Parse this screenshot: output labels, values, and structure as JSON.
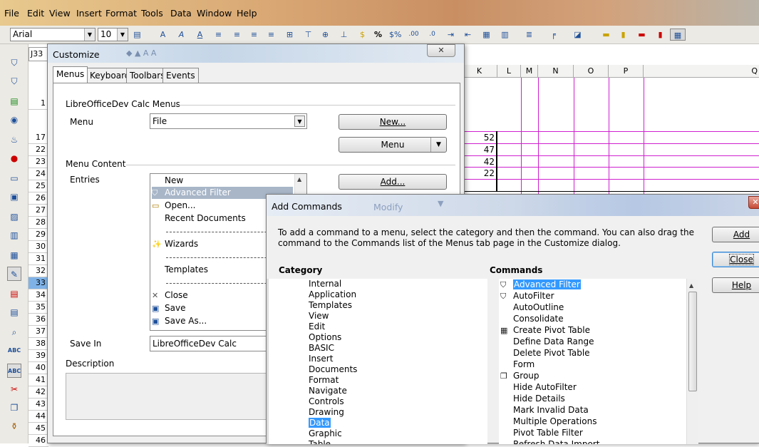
{
  "menubar": {
    "items": [
      "File",
      "Edit",
      "View",
      "Insert",
      "Format",
      "Tools",
      "Data",
      "Window",
      "Help"
    ]
  },
  "format_toolbar": {
    "font_name": "Arial",
    "font_size": "10"
  },
  "sheet": {
    "name_box": "J33",
    "columns": [
      "K",
      "L",
      "M",
      "N",
      "O",
      "P",
      "Q"
    ],
    "rows": [
      "1",
      "17",
      "22",
      "23",
      "24",
      "25",
      "26",
      "27",
      "28",
      "29",
      "30",
      "31",
      "32",
      "33",
      "34",
      "35",
      "36",
      "37",
      "38",
      "39",
      "40",
      "41",
      "42",
      "43",
      "44",
      "45",
      "46"
    ],
    "selected_row": "33",
    "cell_values": [
      "52",
      "47",
      "42",
      "22"
    ]
  },
  "customize": {
    "title": "Customize",
    "close_glyph": "✕",
    "tabs": [
      "Menus",
      "Keyboard",
      "Toolbars",
      "Events"
    ],
    "group_menus": "LibreOfficeDev Calc Menus",
    "menu_label": "Menu",
    "menu_value": "File",
    "new_button": "New...",
    "menu_button": "Menu",
    "group_content": "Menu Content",
    "entries_label": "Entries",
    "entries": [
      {
        "label": "New",
        "icon": "none"
      },
      {
        "label": "Advanced Filter",
        "icon": "filter-icon"
      },
      {
        "label": "Open...",
        "icon": "folder-open-icon"
      },
      {
        "label": "Recent Documents",
        "icon": "none"
      },
      {
        "label": "Wizards",
        "icon": "wizard-icon"
      },
      {
        "label": "Templates",
        "icon": "none"
      },
      {
        "label": "Close",
        "icon": "close-icon"
      },
      {
        "label": "Save",
        "icon": "save-icon"
      },
      {
        "label": "Save As...",
        "icon": "save-as-icon"
      }
    ],
    "add_button": "Add...",
    "save_in_label": "Save In",
    "save_in_value": "LibreOfficeDev Calc",
    "description_label": "Description"
  },
  "add_commands": {
    "title": "Add Commands",
    "background_title": "Modify",
    "close_glyph": "✕",
    "instructions": "To add a command to a menu, select the category and then the command. You can also drag the command to the Commands list of the Menus tab page in the Customize dialog.",
    "category_label": "Category",
    "commands_label": "Commands",
    "categories": [
      "Internal",
      "Application",
      "Templates",
      "View",
      "Edit",
      "Options",
      "BASIC",
      "Insert",
      "Documents",
      "Format",
      "Navigate",
      "Controls",
      "Drawing",
      "Data",
      "Graphic",
      "Table"
    ],
    "selected_category": "Data",
    "commands": [
      {
        "label": "Advanced Filter",
        "icon": "filter-icon"
      },
      {
        "label": "AutoFilter",
        "icon": "autofilter-icon"
      },
      {
        "label": "AutoOutline",
        "icon": "none"
      },
      {
        "label": "Consolidate",
        "icon": "none"
      },
      {
        "label": "Create Pivot Table",
        "icon": "pivot-table-icon"
      },
      {
        "label": "Define Data Range",
        "icon": "none"
      },
      {
        "label": "Delete Pivot Table",
        "icon": "none"
      },
      {
        "label": "Form",
        "icon": "none"
      },
      {
        "label": "Group",
        "icon": "group-icon"
      },
      {
        "label": "Hide AutoFilter",
        "icon": "none"
      },
      {
        "label": "Hide Details",
        "icon": "none"
      },
      {
        "label": "Mark Invalid Data",
        "icon": "none"
      },
      {
        "label": "Multiple Operations",
        "icon": "none"
      },
      {
        "label": "Pivot Table Filter",
        "icon": "none"
      },
      {
        "label": "Refresh Data Import",
        "icon": "none"
      }
    ],
    "selected_command": "Advanced Filter",
    "add_button": "Add",
    "close_button": "Close",
    "help_button": "Help"
  }
}
